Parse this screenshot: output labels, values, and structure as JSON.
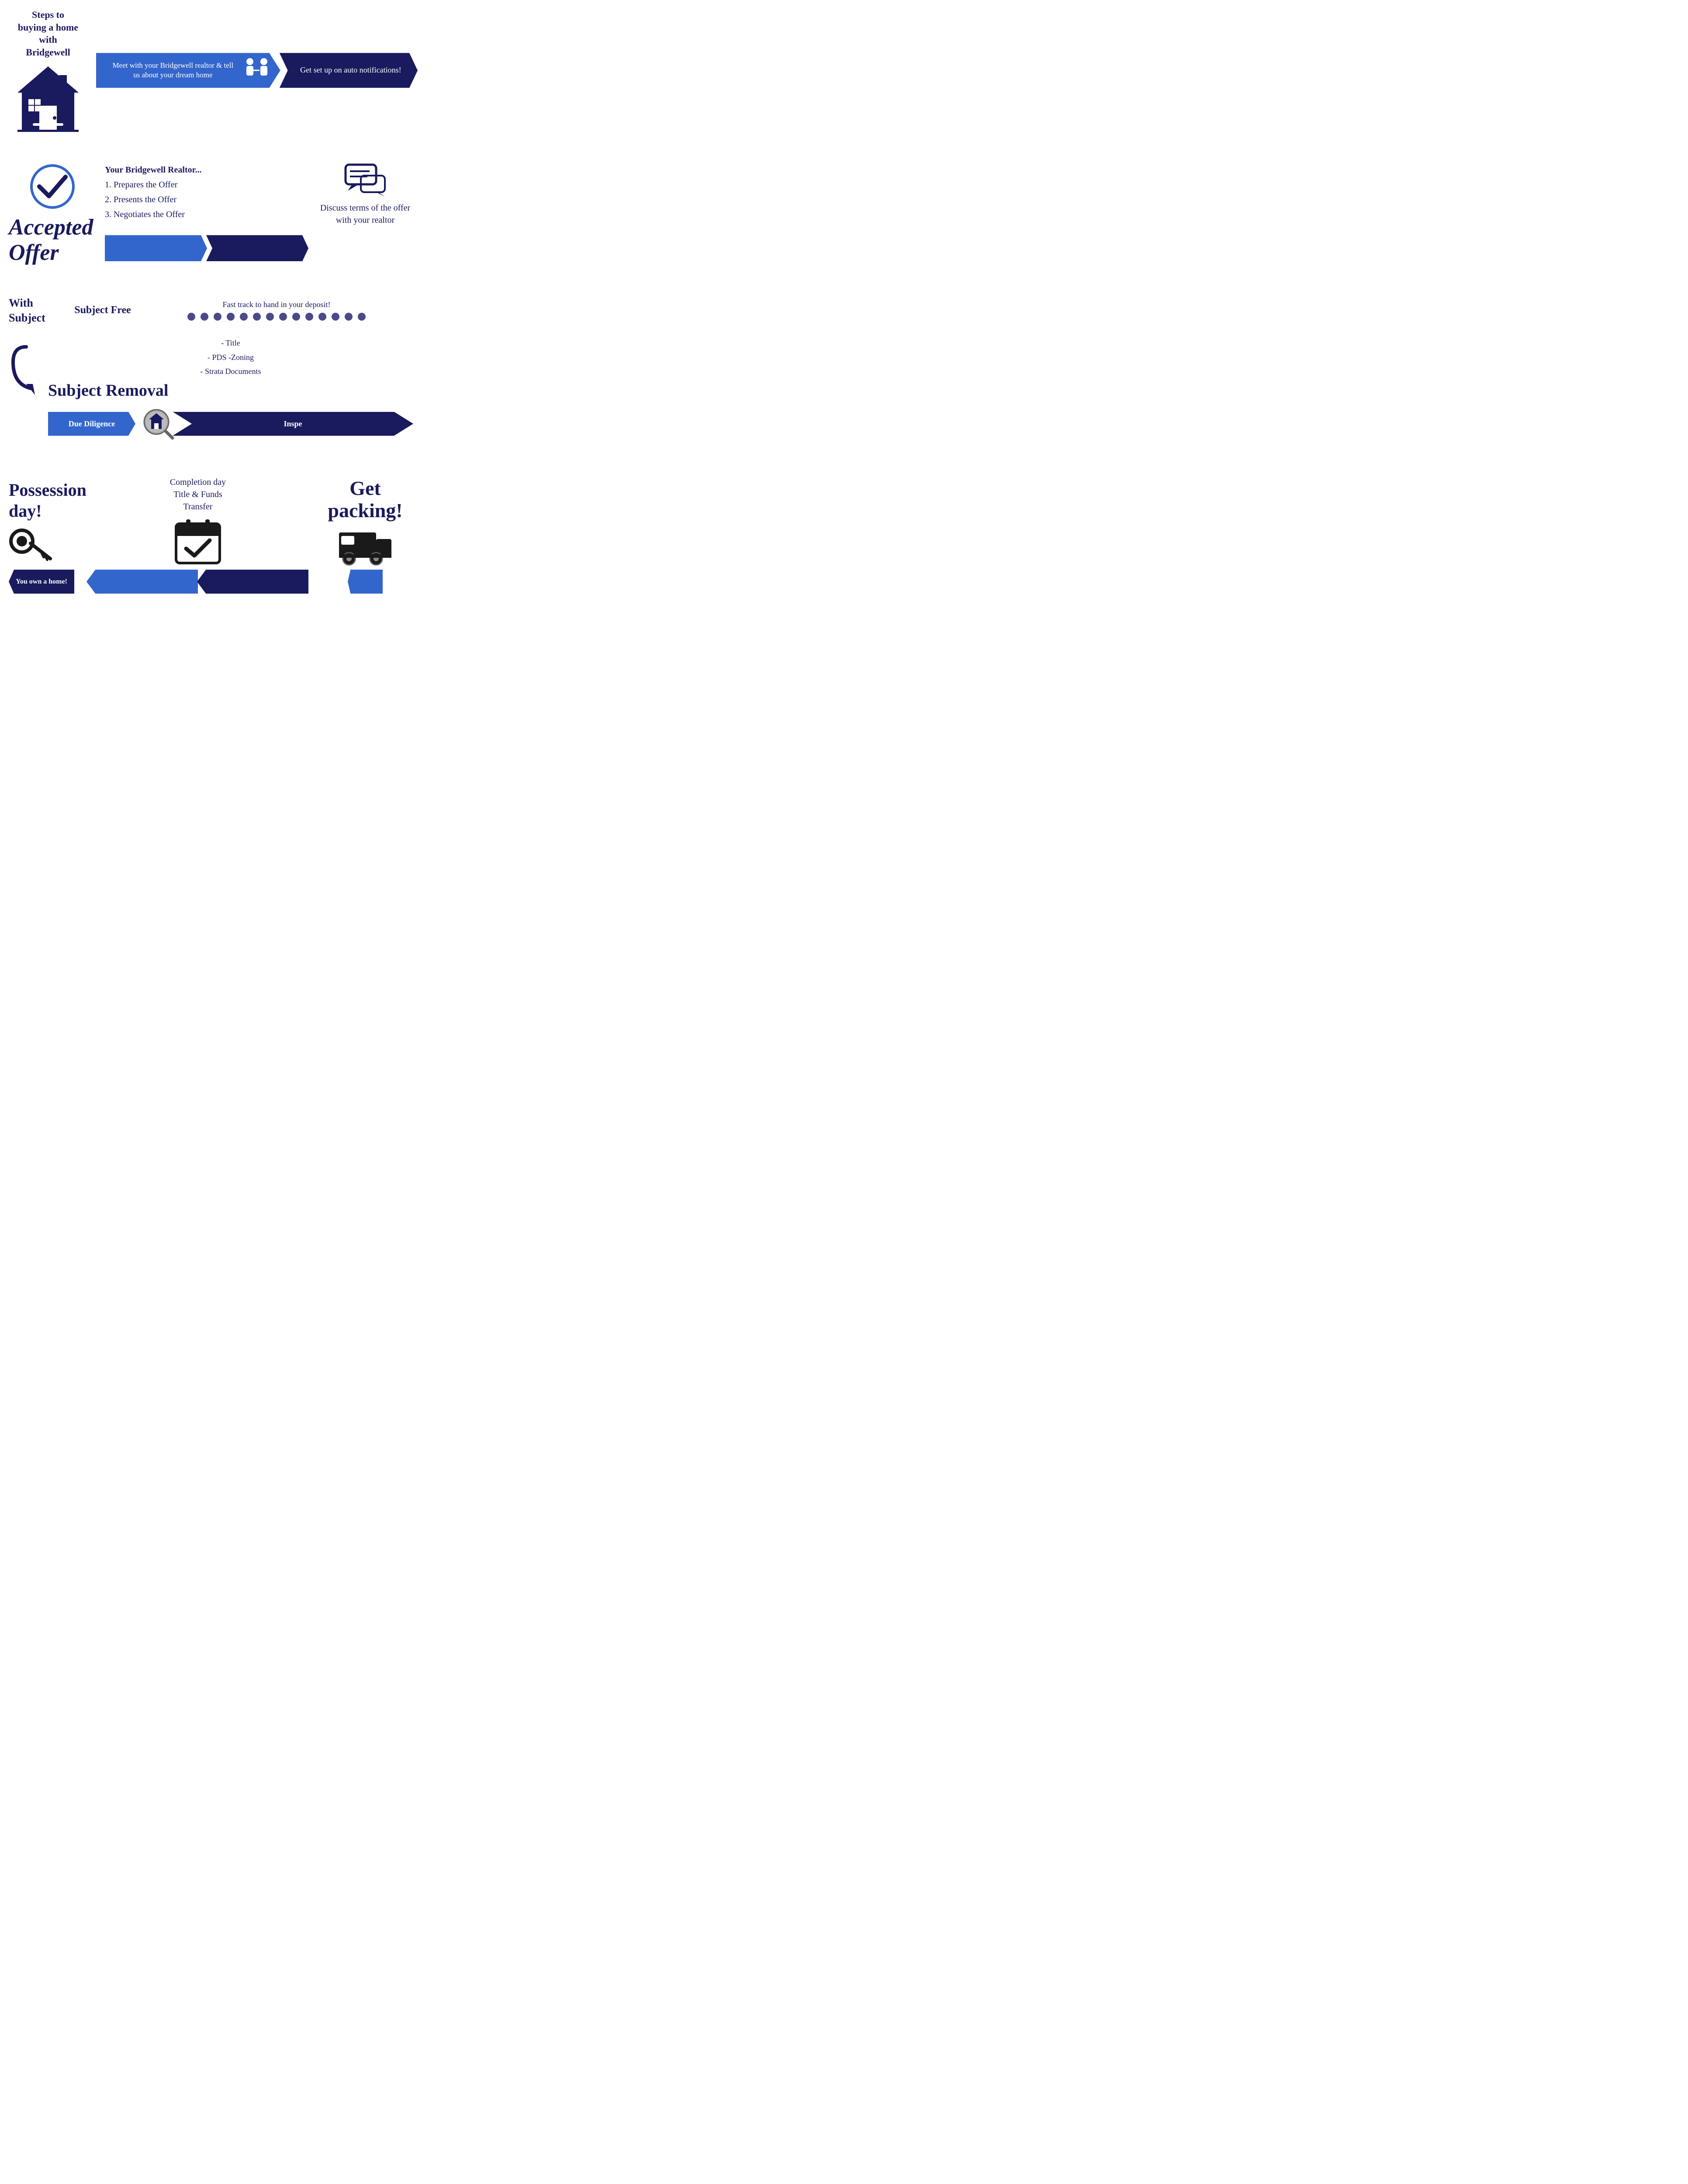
{
  "section1": {
    "steps_line1": "Steps to",
    "steps_line2": "buying a home",
    "steps_line3": "with",
    "steps_line4": "Bridgewell",
    "arrow1_text": "Meet with your Bridgewell realtor & tell us about your dream home",
    "arrow2_text": "Get set up on auto notifications!",
    "dots_count": 14
  },
  "section2": {
    "accepted_offer": "Accepted Offer",
    "realtor_heading": "Your Bridgewell Realtor...",
    "item1": "1. Prepares the Offer",
    "item2": "2. Presents the Offer",
    "item3": "3. Negotiates the Offer",
    "discuss_text": "Discuss terms of the offer with your realtor"
  },
  "section3": {
    "with_subject": "With Subject",
    "subject_free": "Subject Free",
    "fast_track": "Fast track to hand in your deposit!",
    "subject_removal": "Subject Removal",
    "title_items": "- Title\n- PDS -Zoning\n- Strata Documents",
    "due_diligence": "Due Diligence",
    "inspection_partial": "Inspe"
  },
  "section4": {
    "possession": "Possession day!",
    "you_own": "You own a home!",
    "completion_line1": "Completion day",
    "completion_line2": "Title & Funds",
    "completion_line3": "Transfer",
    "get_packing": "Get packing!"
  },
  "colors": {
    "dark_blue": "#1a1a5e",
    "medium_blue": "#3366cc",
    "dot_color": "#5a5a8a",
    "text_dark": "#1a1a5e"
  }
}
